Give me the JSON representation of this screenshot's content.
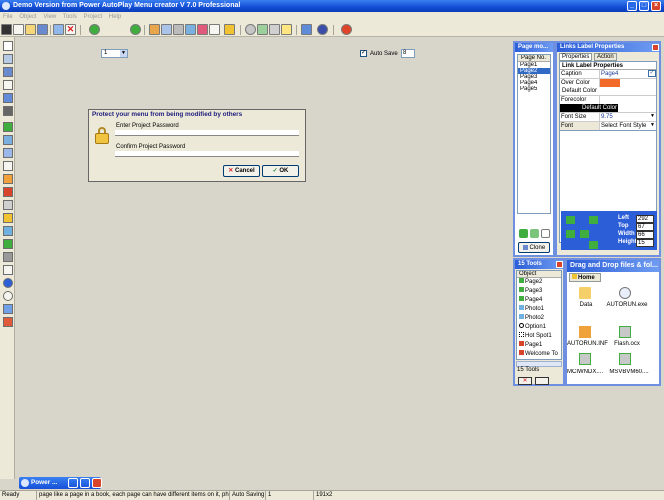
{
  "window": {
    "title": "Demo Version from Power AutoPlay Menu creator V 7.0 Professional"
  },
  "menu": [
    "File",
    "Object",
    "View",
    "Tools",
    "Project",
    "Help"
  ],
  "toolbar": {
    "page_select": "1",
    "autosave_label": "Auto Save",
    "autosave_value": "8"
  },
  "dialog": {
    "title": "Protect your menu from being modified by others",
    "enter_label": "Enter Project Password",
    "enter_value": "",
    "confirm_label": "Confirm Project Password",
    "confirm_value": "",
    "cancel": "Cancel",
    "ok": "OK"
  },
  "pages_panel": {
    "title": "Page mo...",
    "header": "Page No.",
    "items": [
      "Page1",
      "Page2",
      "Page3",
      "Page4",
      "Page5"
    ],
    "selected": "Page2",
    "clone": "Clone"
  },
  "props_panel": {
    "title": "Links Label Properties",
    "tab_properties": "Properties",
    "tab_action": "Action",
    "section": "Link Label Properties",
    "rows": [
      {
        "name": "Caption",
        "value": "Page4"
      },
      {
        "name": "Over Color",
        "value": "Default Color"
      },
      {
        "name": "Forecolor",
        "value": "Default Color"
      },
      {
        "name": "Font Size",
        "value": "9.75"
      },
      {
        "name": "Font",
        "value": "Select Font Style"
      }
    ],
    "over_color_hex": "#f26a2a",
    "forecolor_hex": "#000000"
  },
  "position": {
    "left_label": "Left",
    "left_value": "292",
    "top_label": "Top",
    "top_value": "67",
    "width_label": "Width",
    "width_value": "66",
    "height_label": "Height",
    "height_value": "15"
  },
  "objects_panel": {
    "title": "15 Tools",
    "header": "Object",
    "items": [
      "Page2",
      "Page3",
      "Page4",
      "Photo1",
      "Photo2",
      "Option1",
      "Hot Spot1",
      "Page1",
      "Welcome To"
    ],
    "footer": "15 Tools"
  },
  "files_panel": {
    "title": "Drag and Drop files & fol...",
    "tab": "Home",
    "files": [
      {
        "name": "Data",
        "icon": "folder-icon"
      },
      {
        "name": "AUTORUN.exe",
        "icon": "cd-icon"
      },
      {
        "name": "AUTORUN.INF",
        "icon": "inf-file-icon"
      },
      {
        "name": "Flash.ocx",
        "icon": "ocx-file-icon"
      },
      {
        "name": "MCIWNDX....",
        "icon": "ocx-file-icon"
      },
      {
        "name": "MSVBVM60....",
        "icon": "ocx-file-icon"
      }
    ]
  },
  "taskbar": {
    "label": "Power ..."
  },
  "status": {
    "ready": "Ready",
    "message": "page like a page in a book, each page can have different items on it, photogr",
    "autosaving": "Auto Saving",
    "autosave_value": "1",
    "dims": "191x2"
  },
  "colors": {
    "title_blue": "#1550d8",
    "panel_border": "#6f8fe0",
    "selection": "#316ac5"
  }
}
